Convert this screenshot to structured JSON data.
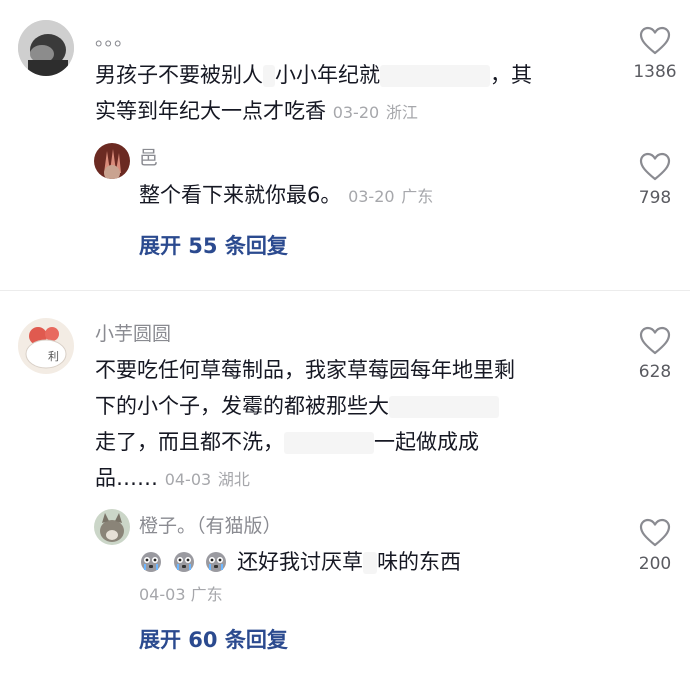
{
  "comments": [
    {
      "username": "。。。",
      "text_line1_a": "男孩子不要被别人",
      "text_line1_b": "小小年纪就",
      "text_line1_c": "，其",
      "text_line2": "实等到年纪大一点才吃香",
      "date": "03-20",
      "location": "浙江",
      "likes": "1386",
      "reply": {
        "username": "邑",
        "text": "整个看下来就你最6。",
        "date": "03-20",
        "location": "广东",
        "likes": "798"
      },
      "expand_label": "展开 55 条回复"
    },
    {
      "username": "小芋圆圆",
      "text_line1": "不要吃任何草莓制品，我家草莓园每年地里剩",
      "text_line2_a": "下的小个子，发霉的都被那些大",
      "text_line3_a": "走了，而且都不洗，",
      "text_line3_b": "一起做成成",
      "text_line4": "品……",
      "date": "04-03",
      "location": "湖北",
      "likes": "628",
      "reply": {
        "username": "橙子。（有猫版）",
        "text_a": "还好我讨厌草",
        "text_b": "味的东西",
        "date": "04-03",
        "location": "广东",
        "likes": "200"
      },
      "expand_label": "展开 60 条回复"
    }
  ],
  "icons": {
    "like": "heart-outline-icon",
    "emoji": "crying-face-emoji"
  },
  "colors": {
    "text": "#161823",
    "username": "#8a8b91",
    "meta": "#a6a7ab",
    "expand": "#2b4a8f"
  }
}
